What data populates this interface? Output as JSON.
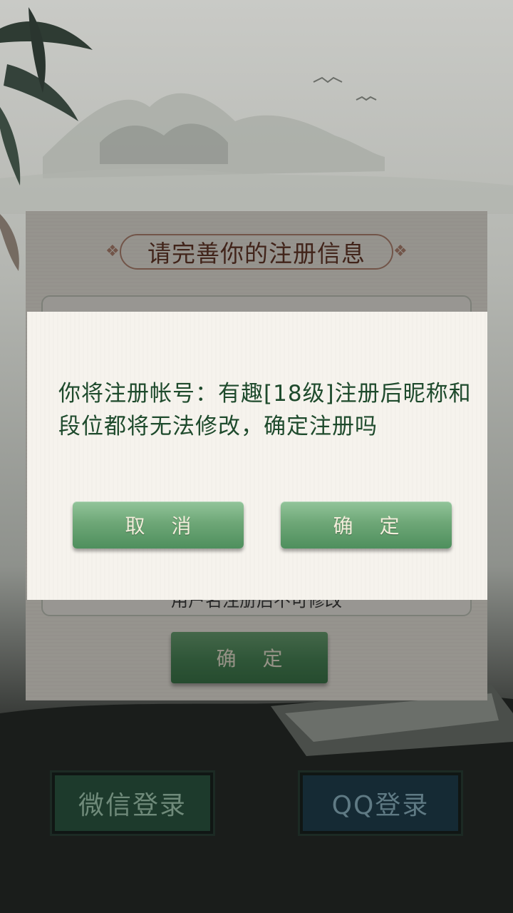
{
  "registration": {
    "title": "请完善你的注册信息",
    "hint": "用户名注册后不可修改",
    "confirm_label": "确 定"
  },
  "login": {
    "wechat_label": "微信登录",
    "qq_label": "QQ登录"
  },
  "dialog": {
    "message": "你将注册帐号：有趣[18级]注册后昵称和段位都将无法修改，确定注册吗",
    "cancel_label": "取 消",
    "ok_label": "确 定"
  },
  "colors": {
    "accent_green": "#5a9a68",
    "text_green": "#1e4a2c",
    "title_brown": "#6a3a2a"
  }
}
